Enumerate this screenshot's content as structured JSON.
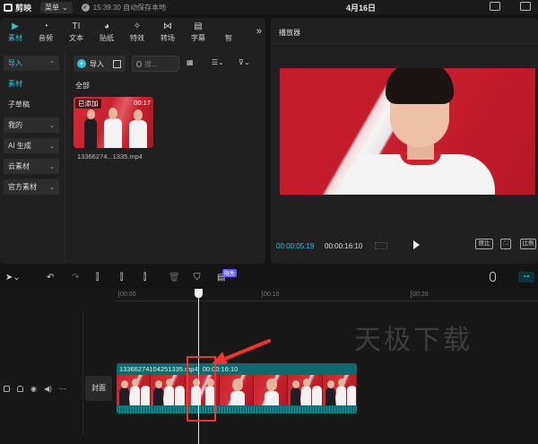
{
  "topbar": {
    "app_name": "剪映",
    "menu_label": "菜单",
    "save_status": "15:39:30 自动保存本地",
    "date": "4月16日"
  },
  "media_tools": [
    {
      "label": "素材",
      "icon": "▶",
      "active": true
    },
    {
      "label": "音频",
      "icon": "◔",
      "active": false
    },
    {
      "label": "文本",
      "icon": "TI",
      "active": false
    },
    {
      "label": "贴纸",
      "icon": "◕",
      "active": false
    },
    {
      "label": "特效",
      "icon": "✧",
      "active": false
    },
    {
      "label": "转场",
      "icon": "⋈",
      "active": false
    },
    {
      "label": "字幕",
      "icon": "▤",
      "active": false
    },
    {
      "label": "智",
      "icon": "",
      "active": false
    }
  ],
  "media_tools_more": "»",
  "categories": {
    "import": "导入",
    "material": "素材",
    "subdraft": "子草稿",
    "mine": "我的",
    "ai": "AI 生成",
    "cloud": "云素材",
    "official": "官方素材"
  },
  "media": {
    "import_label": "导入",
    "search_placeholder": "搜...",
    "all_label": "全部",
    "clip": {
      "badge": "已添加",
      "duration": "00:17",
      "filename": "13366274...1335.mp4"
    }
  },
  "player": {
    "title": "播放器",
    "current_time": "00:00:05:19",
    "total_time": "00:00:16:10",
    "btn_ratio": "原比",
    "btn_full": "比例"
  },
  "timeline": {
    "free_badge": "限免",
    "ticks": [
      "00:00",
      "00:10",
      "00:20"
    ],
    "cover_label": "封面",
    "clip_label": "13366274104251335.mp4",
    "clip_duration": "00:00:16:10"
  },
  "watermark": "天极下载",
  "colors": {
    "accent": "#2ec2d6",
    "clip": "#0f6a6f",
    "highlight": "#f2332f"
  }
}
